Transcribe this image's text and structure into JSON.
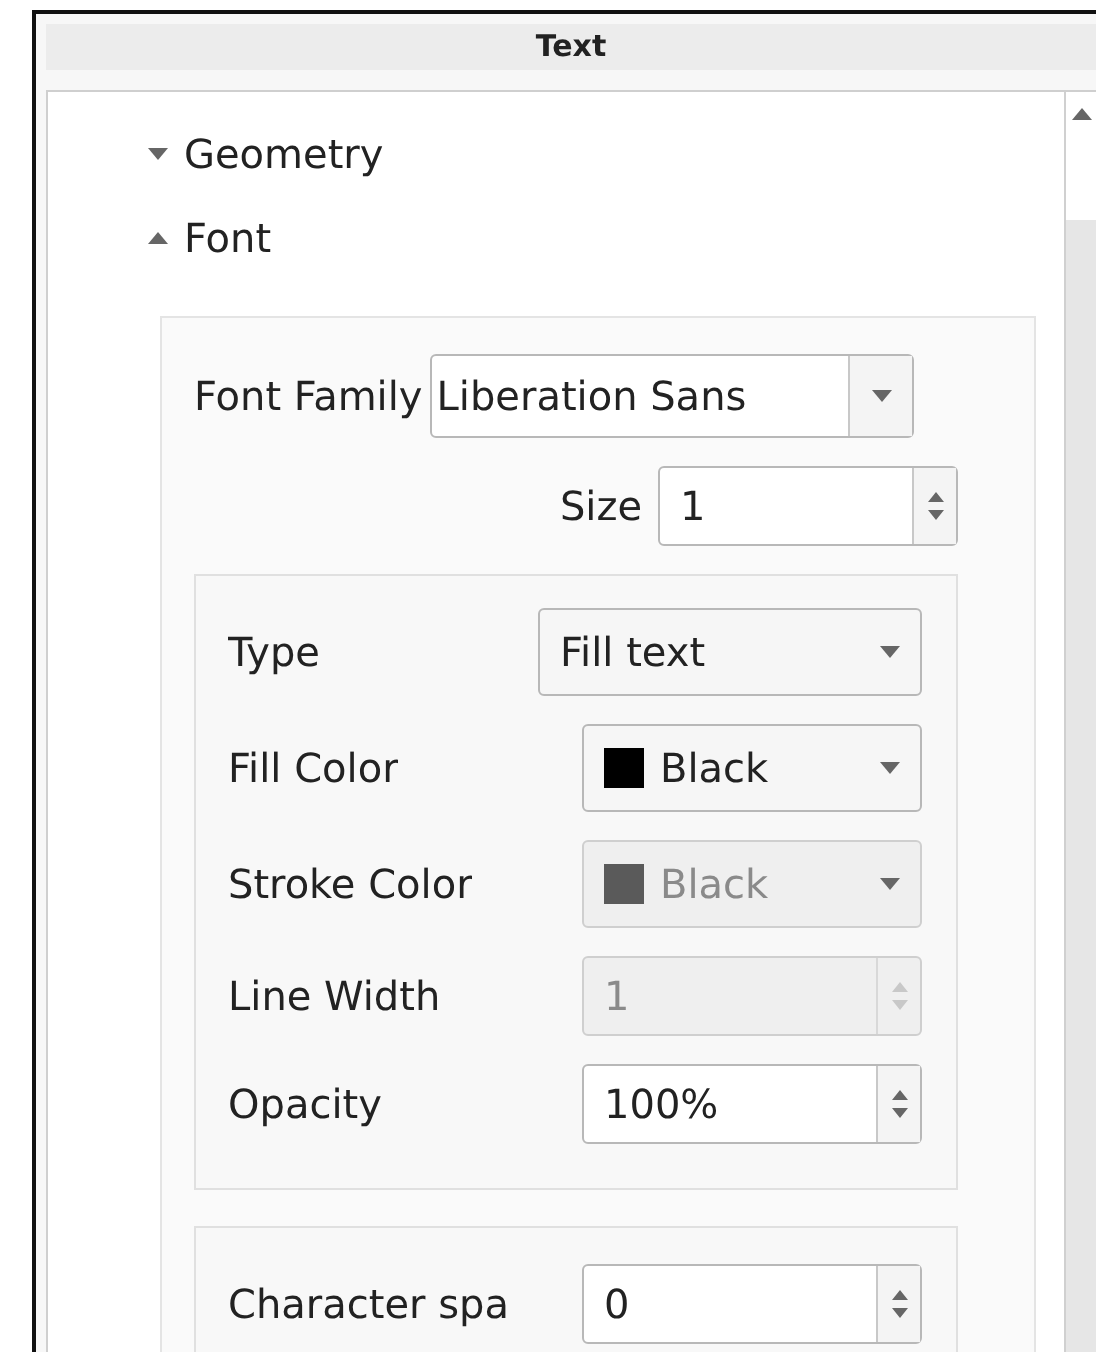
{
  "window": {
    "title": "Text"
  },
  "tree": [
    {
      "label": "Geometry",
      "expanded": false
    },
    {
      "label": "Font",
      "expanded": true
    }
  ],
  "font_family": {
    "label": "Font Family",
    "value": "Liberation Sans"
  },
  "size": {
    "label": "Size",
    "value": "1"
  },
  "style_group": [
    {
      "kind": "combo",
      "label": "Type",
      "value": "Fill text",
      "disabled": false
    },
    {
      "kind": "color",
      "label": "Fill Color",
      "value": "Black",
      "color": "#000000",
      "disabled": false
    },
    {
      "kind": "color",
      "label": "Stroke Color",
      "value": "Black",
      "color": "#5a5a5a",
      "disabled": true
    },
    {
      "kind": "spin",
      "label": "Line Width",
      "value": "1",
      "disabled": true
    },
    {
      "kind": "spin",
      "label": "Opacity",
      "value": "100%",
      "disabled": false
    }
  ],
  "spacing_group": [
    {
      "kind": "spin",
      "label": "Character spa",
      "value": "0",
      "disabled": false
    }
  ]
}
